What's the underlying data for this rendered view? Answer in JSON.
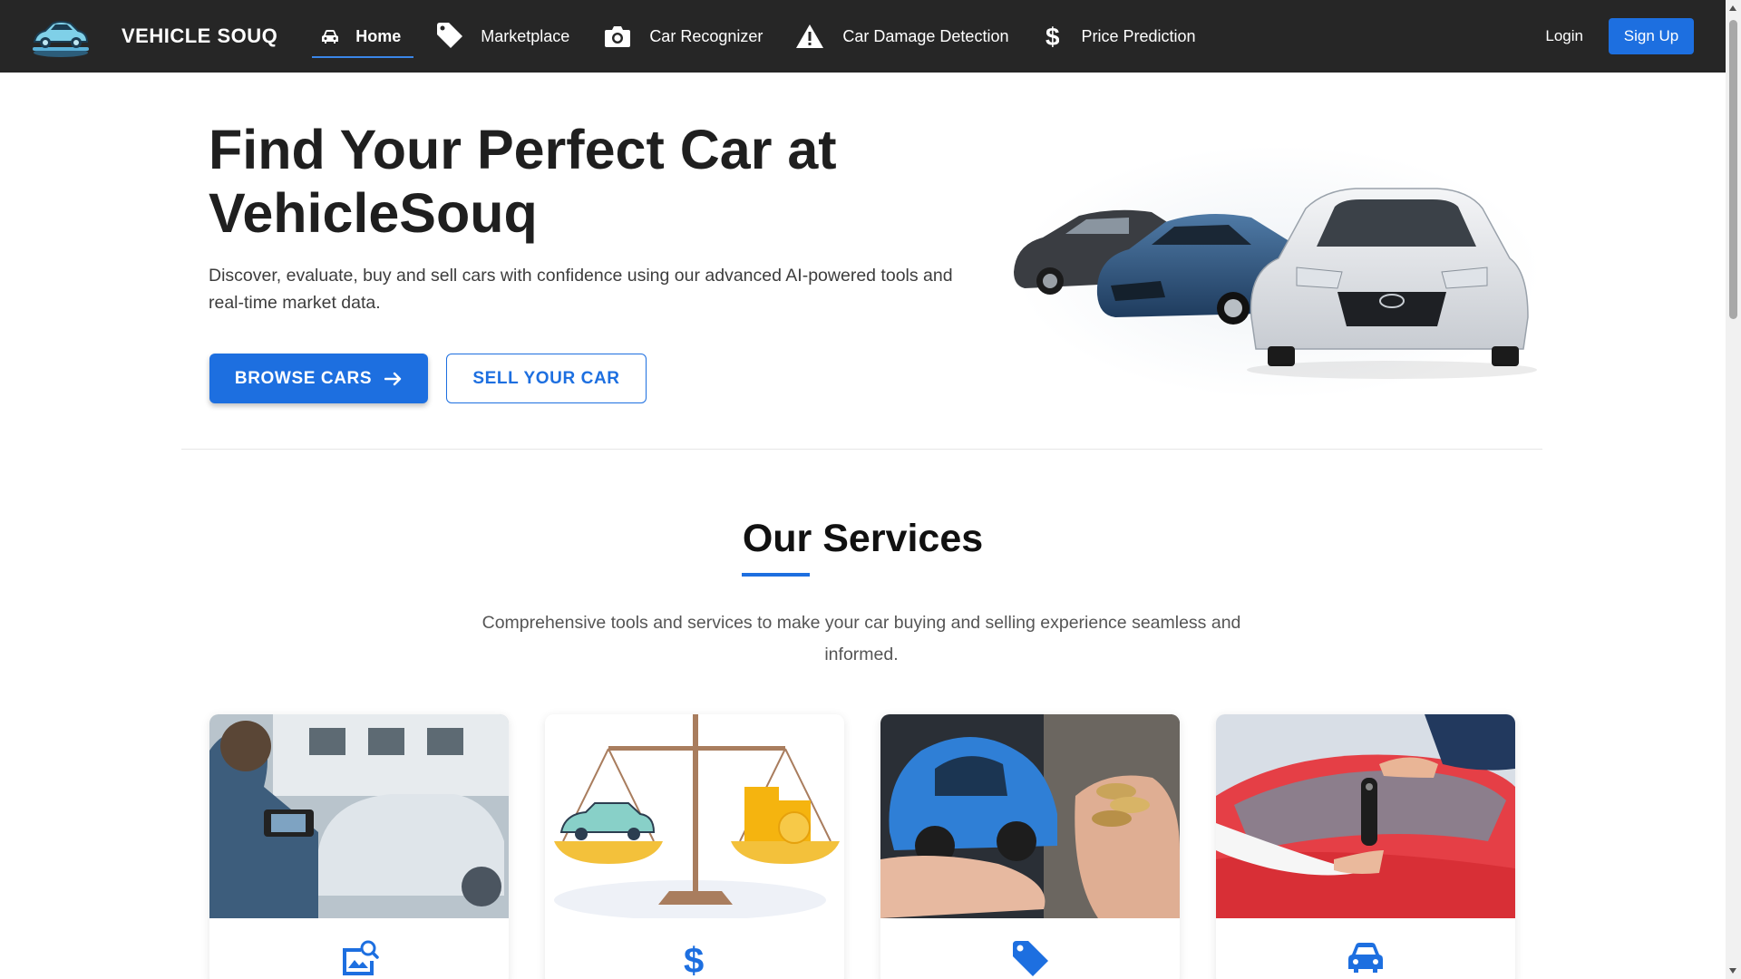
{
  "navbar": {
    "brand": "VEHICLE SOUQ",
    "items": [
      {
        "label": "Home",
        "icon": "car-icon",
        "active": true
      },
      {
        "label": "Marketplace",
        "icon": "tag-icon"
      },
      {
        "label": "Car Recognizer",
        "icon": "camera-icon"
      },
      {
        "label": "Car Damage Detection",
        "icon": "warning-icon"
      },
      {
        "label": "Price Prediction",
        "icon": "dollar-icon"
      }
    ],
    "login": "Login",
    "signup": "Sign Up"
  },
  "hero": {
    "title": "Find Your Perfect Car at VehicleSouq",
    "subtitle": "Discover, evaluate, buy and sell cars with confidence using our advanced AI-powered tools and real-time market data.",
    "browse_label": "BROWSE CARS",
    "sell_label": "SELL YOUR CAR"
  },
  "services": {
    "title": "Our Services",
    "subtitle": "Comprehensive tools and services to make your car buying and selling experience seamless and informed.",
    "cards": [
      {
        "icon": "image-search-icon"
      },
      {
        "icon": "dollar-icon"
      },
      {
        "icon": "tag-icon"
      },
      {
        "icon": "car-icon"
      }
    ]
  },
  "colors": {
    "accent": "#1d6fe0",
    "navbar_bg": "#262626",
    "text": "#1f1f1f"
  }
}
